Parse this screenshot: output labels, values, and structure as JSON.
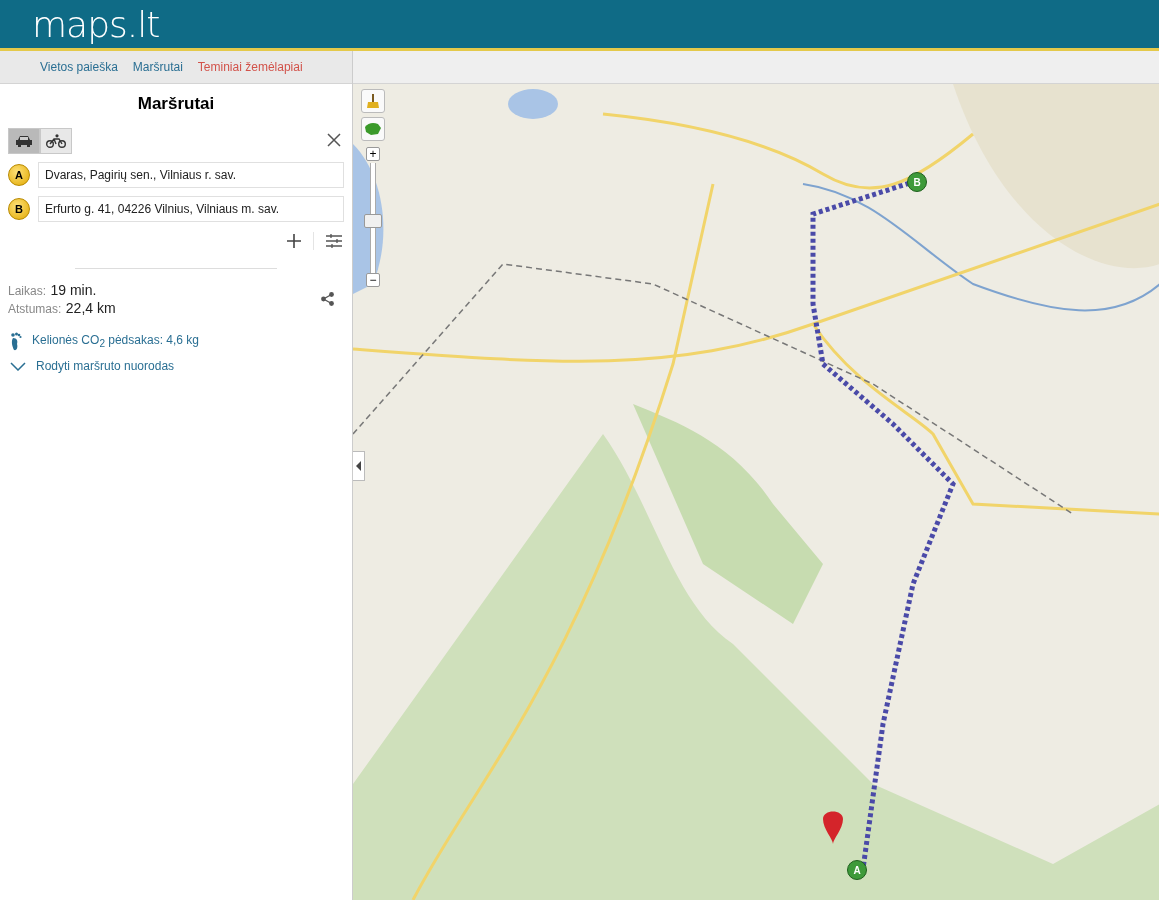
{
  "header": {
    "logo": "maps.lt"
  },
  "nav": [
    {
      "label": "Vietos paieška",
      "kind": "normal"
    },
    {
      "label": "Maršrutai",
      "kind": "normal"
    },
    {
      "label": "Teminiai žemėlapiai",
      "kind": "featured"
    }
  ],
  "panel": {
    "title": "Maršrutai",
    "modes": [
      {
        "kind": "car",
        "selected": true
      },
      {
        "kind": "bike",
        "selected": false
      }
    ],
    "stops": [
      {
        "letter": "A",
        "value": "Dvaras, Pagirių sen., Vilniaus r. sav."
      },
      {
        "letter": "B",
        "value": "Erfurto g. 41, 04226 Vilnius, Vilniaus m. sav."
      }
    ],
    "time_label": "Laikas:",
    "time_value": "19 min.",
    "distance_label": "Atstumas:",
    "distance_value": "22,4 km",
    "co2": "Kelionės CO$_{2}$ pėdsakas: 4,6 kg",
    "directions_link": "Rodyti maršruto nuorodas"
  },
  "map": {
    "zoom_in": "+",
    "zoom_out": "−",
    "zoom": {
      "level": 0.48
    },
    "markers": [
      {
        "letter": "A"
      },
      {
        "letter": "B"
      }
    ]
  }
}
